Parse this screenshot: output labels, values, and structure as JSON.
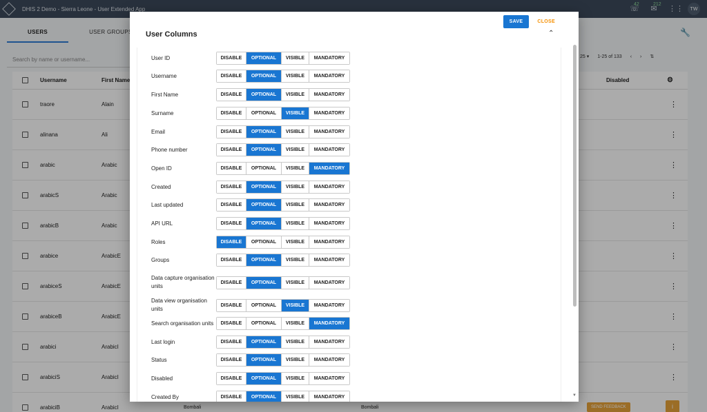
{
  "app": {
    "title": "DHIS 2 Demo - Sierra Leone - User Extended App",
    "notifications": {
      "messages": "42",
      "interpretations": "212"
    },
    "user_initials": "TW"
  },
  "page": {
    "tabs": [
      "USERS",
      "USER GROUPS"
    ],
    "search_placeholder": "Search by name or username...",
    "pager": {
      "per_page": "25",
      "range": "1-25 of 133"
    },
    "columns": {
      "username": "Username",
      "first_name": "First Name",
      "disabled": "Disabled"
    },
    "rows": [
      {
        "username": "traore",
        "first": "Alain"
      },
      {
        "username": "alinana",
        "first": "Ali"
      },
      {
        "username": "arabic",
        "first": "Arabic"
      },
      {
        "username": "arabicS",
        "first": "Arabic"
      },
      {
        "username": "arabicB",
        "first": "Arabic"
      },
      {
        "username": "arabice",
        "first": "ArabicE"
      },
      {
        "username": "arabiceS",
        "first": "ArabicE"
      },
      {
        "username": "arabiceB",
        "first": "ArabicE"
      },
      {
        "username": "arabici",
        "first": "ArabicI"
      },
      {
        "username": "arabiciS",
        "first": "ArabicI"
      },
      {
        "username": "arabiciB",
        "first": "ArabicI"
      }
    ],
    "last_row_extra": {
      "org": "Bombali",
      "group": "Bombali"
    },
    "feedback_label": "SEND FEEDBACK"
  },
  "modal": {
    "save_label": "SAVE",
    "close_label": "CLOSE",
    "title": "User Columns",
    "options": [
      "DISABLE",
      "OPTIONAL",
      "VISIBLE",
      "MANDATORY"
    ],
    "fields": [
      {
        "label": "User ID",
        "selected": "OPTIONAL"
      },
      {
        "label": "Username",
        "selected": "OPTIONAL"
      },
      {
        "label": "First Name",
        "selected": "OPTIONAL"
      },
      {
        "label": "Surname",
        "selected": "VISIBLE"
      },
      {
        "label": "Email",
        "selected": "OPTIONAL"
      },
      {
        "label": "Phone number",
        "selected": "OPTIONAL"
      },
      {
        "label": "Open ID",
        "selected": "MANDATORY"
      },
      {
        "label": "Created",
        "selected": "OPTIONAL"
      },
      {
        "label": "Last updated",
        "selected": "OPTIONAL"
      },
      {
        "label": "API URL",
        "selected": "OPTIONAL"
      },
      {
        "label": "Roles",
        "selected": "DISABLE"
      },
      {
        "label": "Groups",
        "selected": "OPTIONAL"
      },
      {
        "label": "Data capture organisation units",
        "selected": "OPTIONAL"
      },
      {
        "label": "Data view organisation units",
        "selected": "VISIBLE"
      },
      {
        "label": "Search organisation units",
        "selected": "MANDATORY"
      },
      {
        "label": "Last login",
        "selected": "OPTIONAL"
      },
      {
        "label": "Status",
        "selected": "OPTIONAL"
      },
      {
        "label": "Disabled",
        "selected": "OPTIONAL"
      },
      {
        "label": "Created By",
        "selected": "OPTIONAL"
      }
    ]
  }
}
